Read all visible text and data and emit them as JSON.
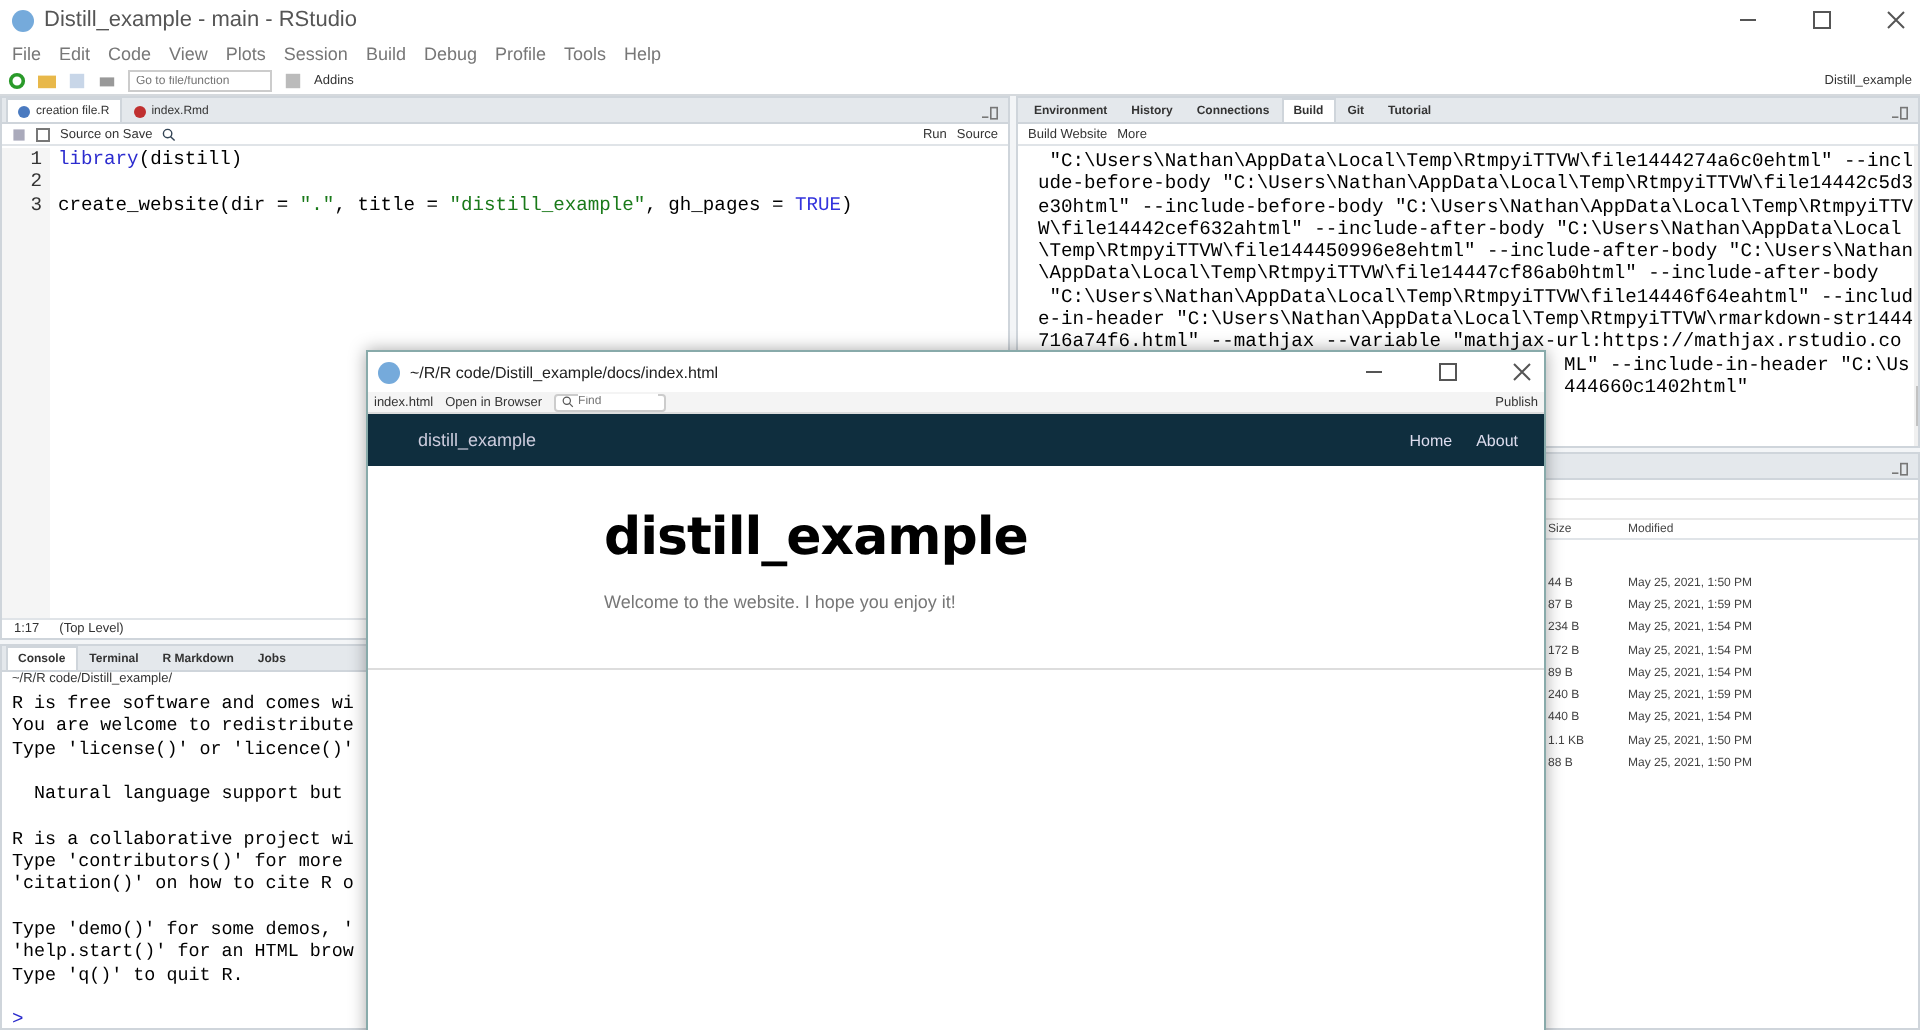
{
  "window": {
    "title": "Distill_example - main - RStudio"
  },
  "menu": [
    "File",
    "Edit",
    "Code",
    "View",
    "Plots",
    "Session",
    "Build",
    "Debug",
    "Profile",
    "Tools",
    "Help"
  ],
  "toolbar": {
    "goto_placeholder": "Go to file/function",
    "addins": "Addins",
    "project": "Distill_example"
  },
  "editor": {
    "tabs": [
      {
        "label": "creation file.R",
        "kind": "r",
        "selected": true
      },
      {
        "label": "index.Rmd",
        "kind": "rmd",
        "selected": false
      }
    ],
    "source_on_save": {
      "label": "Source on Save",
      "checked": false
    },
    "run": "Run",
    "source": "Source",
    "lines": [
      {
        "number": "1",
        "tokens": [
          {
            "kind": "fn",
            "text": "library"
          },
          {
            "kind": "plain",
            "text": "(distill)"
          }
        ]
      },
      {
        "number": "2"
      },
      {
        "number": "3",
        "tokens": [
          {
            "kind": "plain",
            "text": "create_website(dir = "
          },
          {
            "kind": "string",
            "text": "\".\""
          },
          {
            "kind": "plain",
            "text": ", title = "
          },
          {
            "kind": "string",
            "text": "\"distill_example\""
          },
          {
            "kind": "plain",
            "text": ", gh_pages = "
          },
          {
            "kind": "keyword",
            "text": "TRUE"
          },
          {
            "kind": "plain",
            "text": ")"
          }
        ]
      }
    ],
    "position": "1:17",
    "scope": "(Top Level)"
  },
  "console": {
    "tabs": [
      {
        "label": "Console",
        "selected": true
      },
      {
        "label": "Terminal",
        "selected": false
      },
      {
        "label": "R Markdown",
        "selected": false
      },
      {
        "label": "Jobs",
        "selected": false
      }
    ],
    "path": "~/R/R code/Distill_example/",
    "blocks": [
      [
        "R is free software and comes wi",
        "You are welcome to redistribute",
        "Type 'license()' or 'licence()'"
      ],
      [
        "  Natural language support but"
      ],
      [
        "R is a collaborative project wi",
        "Type 'contributors()' for more",
        "'citation()' on how to cite R o"
      ],
      [
        "Type 'demo()' for some demos, '",
        "'help.start()' for an HTML brow",
        "Type 'q()' to quit R."
      ]
    ],
    "prompt": ">"
  },
  "build": {
    "tabs": [
      {
        "label": "Environment",
        "selected": false
      },
      {
        "label": "History",
        "selected": false
      },
      {
        "label": "Connections",
        "selected": false
      },
      {
        "label": "Build",
        "selected": true
      },
      {
        "label": "Git",
        "selected": false
      },
      {
        "label": "Tutorial",
        "selected": false
      }
    ],
    "build_website": "Build Website",
    "more": "More",
    "output": [
      {
        "kind": "full",
        "text": " \"C:\\Users\\Nathan\\AppData\\Local\\Temp\\RtmpyiTTVW\\file1444274a6c0ehtml\" --incl"
      },
      {
        "kind": "full",
        "text": "ude-before-body \"C:\\Users\\Nathan\\AppData\\Local\\Temp\\RtmpyiTTVW\\file14442c5d3"
      },
      {
        "kind": "full",
        "text": "e30html\" --include-before-body \"C:\\Users\\Nathan\\AppData\\Local\\Temp\\RtmpyiTTV"
      },
      {
        "kind": "full",
        "text": "W\\file14442cef632ahtml\" --include-after-body \"C:\\Users\\Nathan\\AppData\\Local"
      },
      {
        "kind": "full",
        "text": "\\Temp\\RtmpyiTTVW\\file144450996e8ehtml\" --include-after-body \"C:\\Users\\Nathan"
      },
      {
        "kind": "full",
        "text": "\\AppData\\Local\\Temp\\RtmpyiTTVW\\file14447cf86ab0html\" --include-after-body"
      },
      {
        "kind": "full",
        "text": " \"C:\\Users\\Nathan\\AppData\\Local\\Temp\\RtmpyiTTVW\\file14446f64eahtml\" --includ"
      },
      {
        "kind": "full",
        "text": "e-in-header \"C:\\Users\\Nathan\\AppData\\Local\\Temp\\RtmpyiTTVW\\rmarkdown-str1444"
      },
      {
        "kind": "full",
        "text": "716a74f6.html\" --mathjax --variable \"mathjax-url:https://mathjax.rstudio.co"
      },
      {
        "kind": "partial",
        "text": "ML\" --include-in-header \"C:\\Us"
      },
      {
        "kind": "partial",
        "text": "444660c1402html\""
      }
    ]
  },
  "files": {
    "columns": [
      "Size",
      "Modified"
    ],
    "rows": [
      {
        "size": "44 B",
        "modified": "May 25, 2021, 1:50 PM"
      },
      {
        "size": "87 B",
        "modified": "May 25, 2021, 1:59 PM"
      },
      {
        "size": "234 B",
        "modified": "May 25, 2021, 1:54 PM"
      },
      {
        "size": "172 B",
        "modified": "May 25, 2021, 1:54 PM"
      },
      {
        "size": "89 B",
        "modified": "May 25, 2021, 1:54 PM"
      },
      {
        "size": "240 B",
        "modified": "May 25, 2021, 1:59 PM"
      },
      {
        "size": "440 B",
        "modified": "May 25, 2021, 1:54 PM"
      },
      {
        "size": "1.1 KB",
        "modified": "May 25, 2021, 1:50 PM"
      },
      {
        "size": "88 B",
        "modified": "May 25, 2021, 1:50 PM"
      }
    ]
  },
  "viewer": {
    "title": "~/R/R code/Distill_example/docs/index.html",
    "file": "index.html",
    "open_in_browser": "Open in Browser",
    "find_placeholder": "Find",
    "publish": "Publish",
    "site": {
      "brand": "distill_example",
      "nav": [
        "Home",
        "About"
      ],
      "heading": "distill_example",
      "subtitle": "Welcome to the website. I hope you enjoy it!"
    }
  }
}
